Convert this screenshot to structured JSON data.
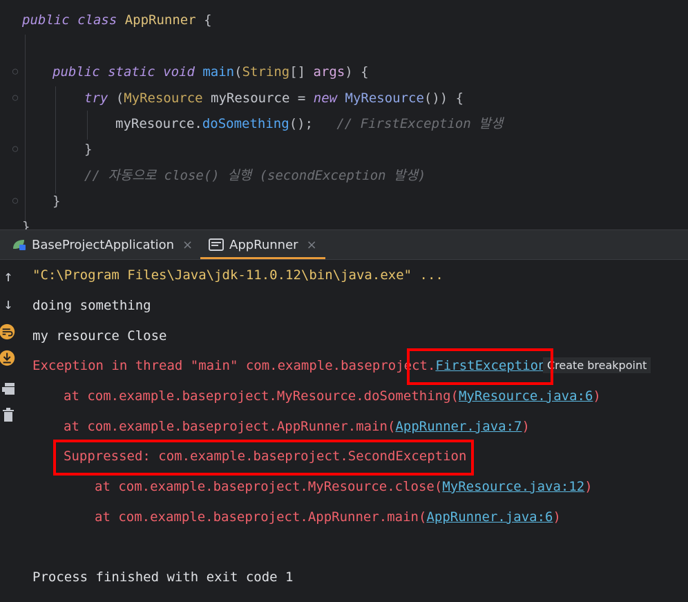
{
  "editor": {
    "lines": [
      {
        "tokens": [
          {
            "t": "public class ",
            "c": "kwi"
          },
          {
            "t": "AppRunner",
            "c": "cls"
          },
          {
            "t": " {",
            "c": "plain"
          }
        ]
      },
      {
        "tokens": [
          {
            "t": "public static void ",
            "c": "kwi"
          },
          {
            "t": "main",
            "c": "call"
          },
          {
            "t": "(",
            "c": "plain"
          },
          {
            "t": "String",
            "c": "typ"
          },
          {
            "t": "[] ",
            "c": "plain"
          },
          {
            "t": "args",
            "c": "param"
          },
          {
            "t": ") {",
            "c": "plain"
          }
        ]
      },
      {
        "tokens": [
          {
            "t": "try ",
            "c": "kwi"
          },
          {
            "t": "(",
            "c": "plain"
          },
          {
            "t": "MyResource",
            "c": "typ"
          },
          {
            "t": " myResource = ",
            "c": "var"
          },
          {
            "t": "new ",
            "c": "new"
          },
          {
            "t": "MyResource",
            "c": "ctor"
          },
          {
            "t": "()) {",
            "c": "plain"
          }
        ]
      },
      {
        "tokens": [
          {
            "t": "myResource.",
            "c": "var"
          },
          {
            "t": "doSomething",
            "c": "call"
          },
          {
            "t": "();   ",
            "c": "plain"
          },
          {
            "t": "// FirstException 발생",
            "c": "cmt"
          }
        ]
      },
      {
        "tokens": [
          {
            "t": "}",
            "c": "plain"
          }
        ]
      },
      {
        "tokens": [
          {
            "t": "// 자동으로 close() 실행 (secondException 발생)",
            "c": "cmt"
          }
        ]
      },
      {
        "tokens": [
          {
            "t": "}",
            "c": "plain"
          }
        ]
      },
      {
        "tokens": [
          {
            "t": "}",
            "c": "plain"
          }
        ]
      }
    ]
  },
  "tabs": [
    {
      "label": "BaseProjectApplication",
      "icon": "spring-leaf-icon",
      "active": false
    },
    {
      "label": "AppRunner",
      "icon": "console-window-icon",
      "active": true
    }
  ],
  "tab_close_glyph": "×",
  "console": {
    "command": "\"C:\\Program Files\\Java\\jdk-11.0.12\\bin\\java.exe\" ...",
    "out1": "doing something",
    "out2": "my resource Close",
    "exception_prefix": "Exception in thread \"main\" com.example.baseproject.",
    "exception_link": "FirstException",
    "hint": "Create breakpoint",
    "trace1_prefix": "at com.example.baseproject.MyResource.doSomething(",
    "trace1_link": "MyResource.java:6",
    "trace2_prefix": "at com.example.baseproject.AppRunner.main(",
    "trace2_link": "AppRunner.java:7",
    "suppressed": "Suppressed: com.example.baseproject.SecondException",
    "trace3_prefix": "at com.example.baseproject.MyResource.close(",
    "trace3_link": "MyResource.java:12",
    "trace4_prefix": "at com.example.baseproject.AppRunner.main(",
    "trace4_link": "AppRunner.java:6",
    "close_paren": ")",
    "exit": "Process finished with exit code 1"
  },
  "side_tools": [
    "up-arrow-icon",
    "down-arrow-icon",
    "soft-wrap-icon",
    "scroll-to-end-icon",
    "print-icon",
    "trash-icon"
  ],
  "colors": {
    "accent_tab": "#e89b3a",
    "annotation_box": "#ff0000",
    "error_text": "#f0616b",
    "link": "#5cb8e0"
  }
}
